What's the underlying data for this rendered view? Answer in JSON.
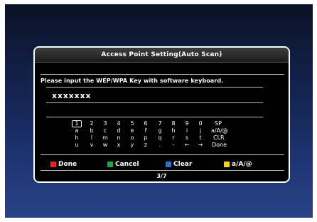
{
  "dialog": {
    "title": "Access Point Setting(Auto Scan)",
    "instruction": "Please input the WEP/WPA Key with software keyboard.",
    "key_value": "xxxxxxx",
    "page_indicator": "3/7"
  },
  "keyboard": {
    "rows": [
      [
        "1",
        "2",
        "3",
        "4",
        "5",
        "6",
        "7",
        "8",
        "9",
        "0",
        "SP"
      ],
      [
        "a",
        "b",
        "c",
        "d",
        "e",
        "f",
        "g",
        "h",
        "i",
        "j",
        "a/A/@"
      ],
      [
        "h",
        "l",
        "m",
        "n",
        "o",
        "p",
        "q",
        "r",
        "s",
        "t",
        "CLR"
      ],
      [
        "u",
        "v",
        "w",
        "x",
        "y",
        "z",
        ".",
        "-",
        "←",
        "→",
        "Done"
      ]
    ],
    "selected": "1"
  },
  "footer": {
    "buttons": [
      {
        "label": "Done",
        "color": "#e8202a"
      },
      {
        "label": "Cancel",
        "color": "#22a34a"
      },
      {
        "label": "Clear",
        "color": "#2f6fd6"
      },
      {
        "label": "a/A/@",
        "color": "#f2d21a"
      }
    ]
  }
}
